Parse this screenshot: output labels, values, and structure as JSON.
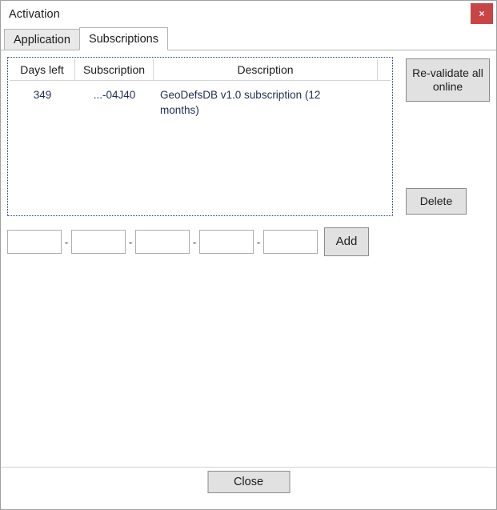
{
  "window": {
    "title": "Activation",
    "close_icon": "close-icon",
    "close_label": "×"
  },
  "tabs": [
    {
      "label": "Application",
      "active": false
    },
    {
      "label": "Subscriptions",
      "active": true
    }
  ],
  "listview": {
    "columns": [
      "Days left",
      "Subscription",
      "Description",
      ""
    ],
    "rows": [
      {
        "days_left": "349",
        "subscription": "...-04J40",
        "description": "GeoDefsDB v1.0 subscription (12 months)"
      }
    ]
  },
  "buttons": {
    "revalidate": "Re-validate all online",
    "delete": "Delete",
    "add": "Add",
    "close": "Close"
  },
  "key_entry": {
    "separator": "-",
    "segments": [
      {
        "value": "",
        "placeholder": ""
      },
      {
        "value": "",
        "placeholder": ""
      },
      {
        "value": "",
        "placeholder": ""
      },
      {
        "value": "",
        "placeholder": ""
      },
      {
        "value": "",
        "placeholder": ""
      }
    ]
  },
  "colors": {
    "close_button": "#c94545",
    "row_text": "#1f2d52",
    "focus_border": "#1b3a6b",
    "button_face": "#e1e1e1"
  }
}
